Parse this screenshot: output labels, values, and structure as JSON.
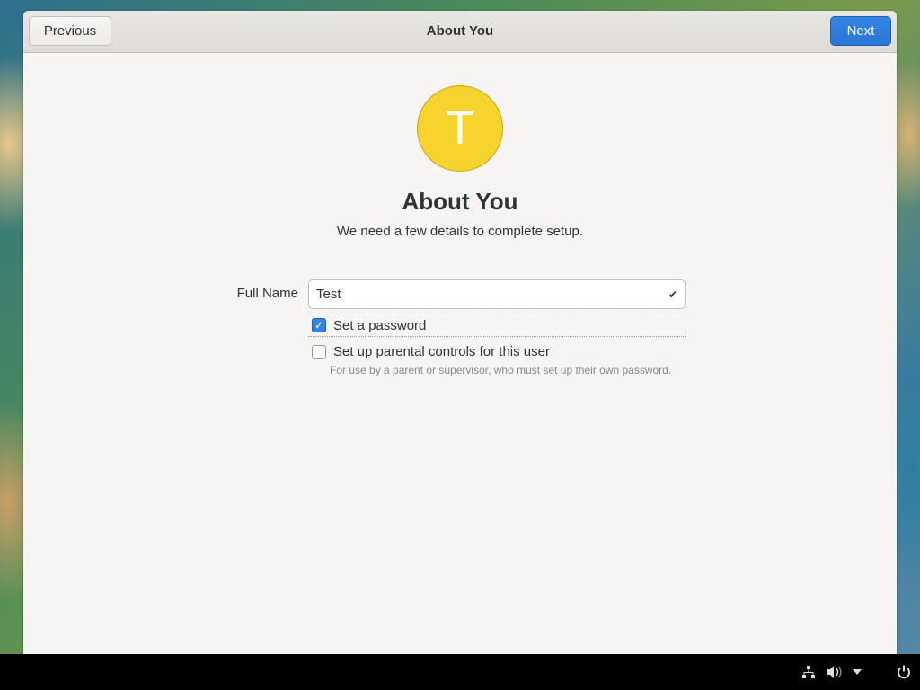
{
  "window": {
    "title": "About You",
    "previous_label": "Previous",
    "next_label": "Next"
  },
  "avatar": {
    "initial": "T",
    "color": "#f6d32d"
  },
  "page": {
    "heading": "About You",
    "subheading": "We need a few details to complete setup."
  },
  "form": {
    "full_name_label": "Full Name",
    "full_name_value": "Test",
    "valid_icon": "checkmark-icon",
    "set_password": {
      "label": "Set a password",
      "checked": true
    },
    "parental_controls": {
      "label": "Set up parental controls for this user",
      "checked": false,
      "description": "For use by a parent or supervisor, who must set up their own password."
    }
  },
  "taskbar": {
    "icons": [
      "network-icon",
      "volume-icon",
      "menu-arrow-icon",
      "power-icon"
    ]
  },
  "colors": {
    "accent": "#3584e4",
    "avatar": "#f6d32d"
  }
}
